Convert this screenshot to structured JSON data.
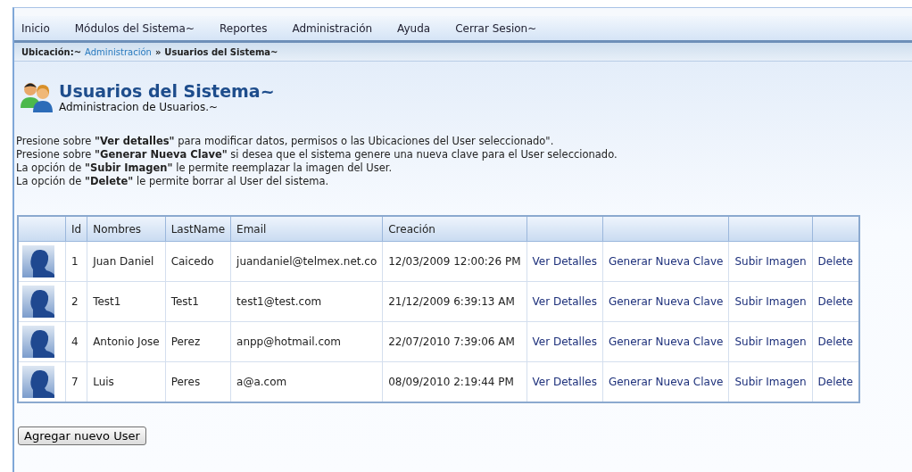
{
  "menu": [
    "Inicio",
    "Módulos del Sistema~",
    "Reportes",
    "Administración",
    "Ayuda",
    "Cerrar Sesion~"
  ],
  "breadcrumb": {
    "label": "Ubicación:~",
    "link": "Administración",
    "separator": "»",
    "current": "Usuarios del Sistema~"
  },
  "header": {
    "title": "Usuarios del Sistema~",
    "subtitle": "Administracion de Usuarios.~"
  },
  "instructions": [
    "Presione sobre **\"Ver detalles\"** para modificar datos, permisos o las Ubicaciones del User seleccionado\".",
    "Presione sobre **\"Generar Nueva Clave\"** si desea que el sistema genere una nueva clave para el User seleccionado.",
    "La opción de **\"Subir Imagen\"** le permite reemplazar la imagen del User.",
    "La opción de **\"Delete\"** le permite borrar al User del sistema."
  ],
  "table": {
    "columns": [
      "Id",
      "Nombres",
      "LastName",
      "Email",
      "Creación"
    ],
    "rows": [
      {
        "id": "1",
        "nombres": "Juan Daniel",
        "lastname": "Caicedo",
        "email": "juandaniel@telmex.net.co",
        "creacion": "12/03/2009 12:00:26 PM",
        "actions": [
          "Ver Detalles",
          "Generar Nueva Clave",
          "Subir Imagen",
          "Delete"
        ]
      },
      {
        "id": "2",
        "nombres": "Test1",
        "lastname": "Test1",
        "email": "test1@test.com",
        "creacion": "21/12/2009 6:39:13 AM",
        "actions": [
          "Ver Detalles",
          "Generar Nueva Clave",
          "Subir Imagen",
          "Delete"
        ]
      },
      {
        "id": "4",
        "nombres": "Antonio Jose",
        "lastname": "Perez",
        "email": "anpp@hotmail.com",
        "creacion": "22/07/2010 7:39:06 AM",
        "actions": [
          "Ver Detalles",
          "Generar Nueva Clave",
          "Subir Imagen",
          "Delete"
        ]
      },
      {
        "id": "7",
        "nombres": "Luis",
        "lastname": "Peres",
        "email": "a@a.com",
        "creacion": "08/09/2010 2:19:44 PM",
        "actions": [
          "Ver Detalles",
          "Generar Nueva Clave",
          "Subir Imagen",
          "Delete"
        ]
      }
    ]
  },
  "add_button": "Agregar nuevo User"
}
